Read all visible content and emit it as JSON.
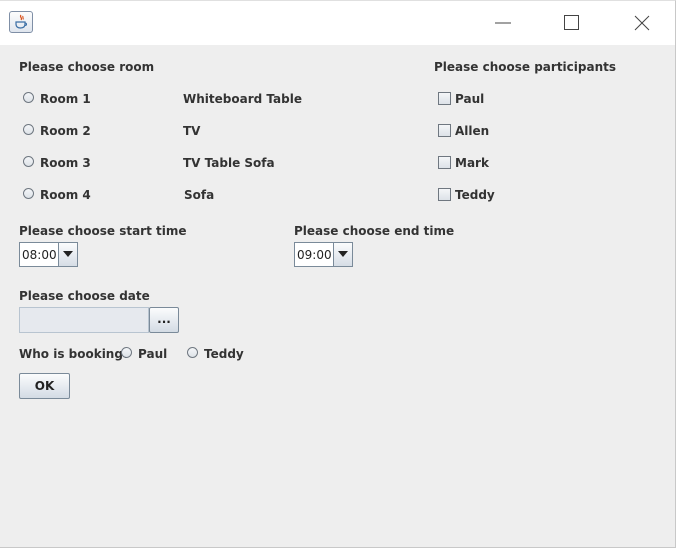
{
  "window": {
    "icon": "java-cup-icon",
    "controls": [
      "minimize-icon",
      "maximize-icon",
      "close-icon"
    ]
  },
  "room": {
    "heading": "Please choose room",
    "options": [
      {
        "label": "Room 1",
        "equipment": "Whiteboard Table"
      },
      {
        "label": "Room 2",
        "equipment": "TV"
      },
      {
        "label": "Room 3",
        "equipment": "TV Table Sofa"
      },
      {
        "label": "Room 4",
        "equipment": "Sofa"
      }
    ]
  },
  "participants": {
    "heading": "Please choose participants",
    "options": [
      "Paul",
      "Allen",
      "Mark",
      "Teddy"
    ]
  },
  "start_time": {
    "heading": "Please choose start time",
    "value": "08:00"
  },
  "end_time": {
    "heading": "Please choose end time",
    "value": "09:00"
  },
  "date": {
    "heading": "Please choose date",
    "value": "",
    "picker_label": "..."
  },
  "booking": {
    "question": "Who is booking?",
    "options": [
      "Paul",
      "Teddy"
    ]
  },
  "ok_button": {
    "label": "OK"
  },
  "colors": {
    "panel_bg": "#eeeeee",
    "titlebar_bg": "#ffffff",
    "text": "#333333"
  }
}
